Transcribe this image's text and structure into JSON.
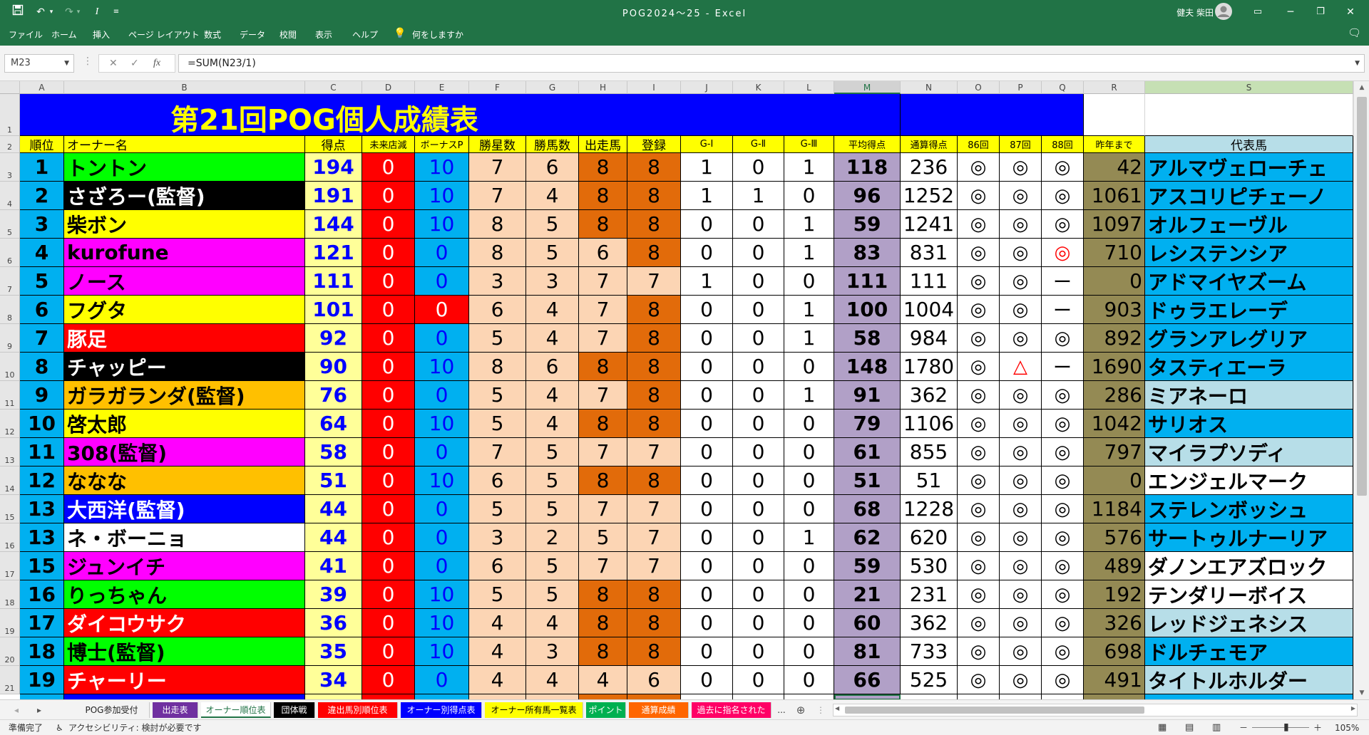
{
  "app": {
    "window_title": "POG2024～25  -  Excel",
    "user": "健夫 柴田",
    "ribbon_tabs": [
      "ファイル",
      "ホーム",
      "挿入",
      "ページ レイアウト",
      "数式",
      "データ",
      "校閲",
      "表示",
      "ヘルプ",
      "何をしますか"
    ],
    "qa_icons": [
      "save-icon",
      "undo-icon",
      "redo-icon",
      "italic-icon",
      "customize-icon"
    ]
  },
  "formula_bar": {
    "name_box": "M23",
    "cancel_glyph": "✕",
    "enter_glyph": "✓",
    "fx_glyph": "fx",
    "formula": "=SUM(N23/1)"
  },
  "sheet": {
    "columns": [
      "A",
      "B",
      "C",
      "D",
      "E",
      "F",
      "G",
      "H",
      "I",
      "J",
      "K",
      "L",
      "M",
      "N",
      "O",
      "P",
      "Q",
      "R",
      "S"
    ],
    "row_numbers": [
      "1",
      "2",
      "3",
      "4",
      "5",
      "6",
      "7",
      "8",
      "9",
      "10",
      "11",
      "12",
      "13",
      "14",
      "15",
      "16",
      "17",
      "18",
      "19",
      "20",
      "21"
    ],
    "title": "第21回POG個人成績表",
    "headers": [
      "順位",
      "オーナー名",
      "得点",
      "未来店減",
      "ボーナスP",
      "勝星数",
      "勝馬数",
      "出走馬",
      "登録",
      "G-Ⅰ",
      "G-Ⅱ",
      "G-Ⅲ",
      "平均得点",
      "通算得点",
      "86回",
      "87回",
      "88回",
      "昨年まで",
      "代表馬"
    ],
    "rows": [
      [
        "1",
        "トントン",
        "194",
        "0",
        "10",
        "7",
        "6",
        "8",
        "8",
        "1",
        "0",
        "1",
        "118",
        "236",
        "◎",
        "◎",
        "◎",
        "42",
        "アルマヴェローチェ"
      ],
      [
        "2",
        "さざろー(監督)",
        "191",
        "0",
        "10",
        "7",
        "4",
        "8",
        "8",
        "1",
        "1",
        "0",
        "96",
        "1252",
        "◎",
        "◎",
        "◎",
        "1061",
        "アスコリピチェーノ"
      ],
      [
        "3",
        "柴ボン",
        "144",
        "0",
        "10",
        "8",
        "5",
        "8",
        "8",
        "0",
        "0",
        "1",
        "59",
        "1241",
        "◎",
        "◎",
        "◎",
        "1097",
        "オルフェーヴル"
      ],
      [
        "4",
        "kurofune",
        "121",
        "0",
        "0",
        "8",
        "5",
        "6",
        "8",
        "0",
        "0",
        "1",
        "83",
        "831",
        "◎",
        "◎",
        "◎",
        "710",
        "レシステンシア"
      ],
      [
        "5",
        "ノース",
        "111",
        "0",
        "0",
        "3",
        "3",
        "7",
        "7",
        "1",
        "0",
        "0",
        "111",
        "111",
        "◎",
        "◎",
        "ー",
        "0",
        "アドマイヤズーム"
      ],
      [
        "6",
        "フグタ",
        "101",
        "0",
        "0",
        "6",
        "4",
        "7",
        "8",
        "0",
        "0",
        "1",
        "100",
        "1004",
        "◎",
        "◎",
        "ー",
        "903",
        "ドゥラエレーデ"
      ],
      [
        "7",
        "豚足",
        "92",
        "0",
        "0",
        "5",
        "4",
        "7",
        "8",
        "0",
        "0",
        "1",
        "58",
        "984",
        "◎",
        "◎",
        "◎",
        "892",
        "グランアレグリア"
      ],
      [
        "8",
        "チャッピー",
        "90",
        "0",
        "10",
        "8",
        "6",
        "8",
        "8",
        "0",
        "0",
        "0",
        "148",
        "1780",
        "◎",
        "△",
        "ー",
        "1690",
        "タスティエーラ"
      ],
      [
        "9",
        "ガラガランダ(監督)",
        "76",
        "0",
        "0",
        "5",
        "4",
        "7",
        "8",
        "0",
        "0",
        "1",
        "91",
        "362",
        "◎",
        "◎",
        "◎",
        "286",
        "ミアネーロ"
      ],
      [
        "10",
        "啓太郎",
        "64",
        "0",
        "10",
        "5",
        "4",
        "8",
        "8",
        "0",
        "0",
        "0",
        "79",
        "1106",
        "◎",
        "◎",
        "◎",
        "1042",
        "サリオス"
      ],
      [
        "11",
        "308(監督)",
        "58",
        "0",
        "0",
        "7",
        "5",
        "7",
        "7",
        "0",
        "0",
        "0",
        "61",
        "855",
        "◎",
        "◎",
        "◎",
        "797",
        "マイラプソディ"
      ],
      [
        "12",
        "ななな",
        "51",
        "0",
        "10",
        "6",
        "5",
        "8",
        "8",
        "0",
        "0",
        "0",
        "51",
        "51",
        "◎",
        "◎",
        "◎",
        "0",
        "エンジェルマーク"
      ],
      [
        "13",
        "大西洋(監督)",
        "44",
        "0",
        "0",
        "5",
        "5",
        "7",
        "7",
        "0",
        "0",
        "0",
        "68",
        "1228",
        "◎",
        "◎",
        "◎",
        "1184",
        "ステレンボッシュ"
      ],
      [
        "13",
        "ネ・ボーニョ",
        "44",
        "0",
        "0",
        "3",
        "2",
        "5",
        "7",
        "0",
        "0",
        "1",
        "62",
        "620",
        "◎",
        "◎",
        "◎",
        "576",
        "サートゥルナーリア"
      ],
      [
        "15",
        "ジュンイチ",
        "41",
        "0",
        "0",
        "6",
        "5",
        "7",
        "7",
        "0",
        "0",
        "0",
        "59",
        "530",
        "◎",
        "◎",
        "◎",
        "489",
        "ダノンエアズロック"
      ],
      [
        "16",
        "りっちゃん",
        "39",
        "0",
        "10",
        "5",
        "5",
        "8",
        "8",
        "0",
        "0",
        "0",
        "21",
        "231",
        "◎",
        "◎",
        "◎",
        "192",
        "テンダリーボイス"
      ],
      [
        "17",
        "ダイコウサク",
        "36",
        "0",
        "10",
        "4",
        "4",
        "8",
        "8",
        "0",
        "0",
        "0",
        "60",
        "362",
        "◎",
        "◎",
        "◎",
        "326",
        "レッドジェネシス"
      ],
      [
        "18",
        "博士(監督)",
        "35",
        "0",
        "10",
        "4",
        "3",
        "8",
        "8",
        "0",
        "0",
        "0",
        "81",
        "733",
        "◎",
        "◎",
        "◎",
        "698",
        "ドルチェモア"
      ],
      [
        "19",
        "チャーリー",
        "34",
        "0",
        "0",
        "4",
        "4",
        "4",
        "6",
        "0",
        "0",
        "0",
        "66",
        "525",
        "◎",
        "◎",
        "◎",
        "491",
        "タイトルホルダー"
      ]
    ],
    "owner_colors": [
      "#00ff00",
      "#000000",
      "#ffff00",
      "#ff00ff",
      "#ff00ff",
      "#ffff00",
      "#ff0000",
      "#000000",
      "#ffc000",
      "#ffff00",
      "#ff00ff",
      "#ffc000",
      "#0000ff",
      "#ffffff",
      "#ff00ff",
      "#00ff00",
      "#ff0000",
      "#00ff00",
      "#ff0000"
    ],
    "owner_text_colors": [
      "#000000",
      "#ffffff",
      "#000000",
      "#000000",
      "#000000",
      "#000000",
      "#ffffff",
      "#ffffff",
      "#000000",
      "#000000",
      "#000000",
      "#000000",
      "#ffffff",
      "#000000",
      "#000000",
      "#000000",
      "#ffffff",
      "#000000",
      "#ffffff"
    ],
    "rank_colors": [
      "#00b0f0",
      "#00b0f0",
      "#00b0f0",
      "#00b0f0",
      "#00b0f0",
      "#00b0f0",
      "#00b0f0",
      "#00b0f0",
      "#00b0f0",
      "#00b0f0",
      "#00b0f0",
      "#00b0f0",
      "#00b0f0",
      "#00b0f0",
      "#00b0f0",
      "#00b0f0",
      "#00b0f0",
      "#00b0f0",
      "#00b0f0"
    ],
    "horse_colors": [
      "#00b0f0",
      "#00b0f0",
      "#00b0f0",
      "#00b0f0",
      "#00b0f0",
      "#00b0f0",
      "#00b0f0",
      "#00b0f0",
      "#b7dee8",
      "#00b0f0",
      "#b7dee8",
      "#ffffff",
      "#00b0f0",
      "#00b0f0",
      "#ffffff",
      "#ffffff",
      "#b7dee8",
      "#00b0f0",
      "#b7dee8"
    ]
  },
  "colors": {
    "excel_green": "#217346",
    "title_bg": "#0000ff",
    "title_text": "#ffff00",
    "header_bg": "#ffff00",
    "score_bg": "#ffff99",
    "score_text": "#0000ff",
    "mirai_bg": "#ff0000",
    "bonus_bg": "#00b0f0",
    "wins_bg": "#fcd5b4",
    "starts_bg": "#e26b0a",
    "avg_bg": "#b1a0c7",
    "prev_bg": "#948a54",
    "horse_hdr_bg": "#b7dee8"
  },
  "tabs": [
    {
      "label": "POG参加受付",
      "bg": "#f3f3f3",
      "fg": "#222222"
    },
    {
      "label": "出走表",
      "bg": "#7030a0",
      "fg": "#ffffff"
    },
    {
      "label": "オーナー順位表",
      "bg": "#ffffff",
      "fg": "#217346"
    },
    {
      "label": "団体戦",
      "bg": "#000000",
      "fg": "#ffffff"
    },
    {
      "label": "違出馬別順位表",
      "bg": "#ff0000",
      "fg": "#ffffff"
    },
    {
      "label": "オーナー別得点表",
      "bg": "#0000ff",
      "fg": "#ffffff"
    },
    {
      "label": "オーナー所有馬一覧表",
      "bg": "#ffff00",
      "fg": "#000000"
    },
    {
      "label": "ポイント",
      "bg": "#00b050",
      "fg": "#ffffff"
    },
    {
      "label": "通算成績",
      "bg": "#ff6600",
      "fg": "#ffffff"
    },
    {
      "label": "過去に指名された",
      "bg": "#ff0066",
      "fg": "#ffffff"
    }
  ],
  "tab_more": "...",
  "tab_add": "⊕",
  "status": {
    "ready": "準備完了",
    "accessibility": "アクセシビリティ: 検討が必要です",
    "zoom": "105%",
    "zoom_minus": "－",
    "zoom_plus": "＋"
  }
}
